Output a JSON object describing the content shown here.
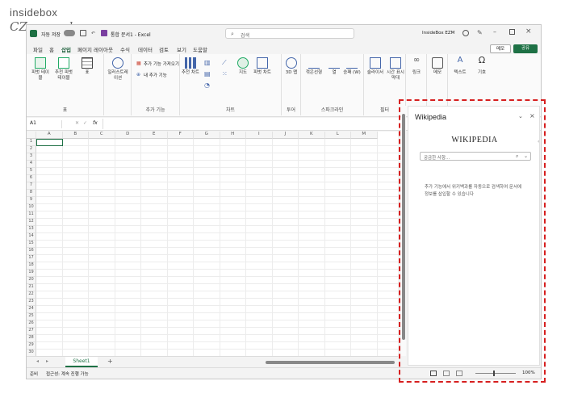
{
  "watermark": {
    "line1": "insidebox",
    "line2": "CZmanual"
  },
  "titlebar": {
    "autosave": "자동 저장",
    "doc_title": "통합 문서1 - Excel",
    "search_placeholder": "검색",
    "user": "InsideBox EZM"
  },
  "tabs": [
    "파일",
    "홈",
    "삽입",
    "페이지 레이아웃",
    "수식",
    "데이터",
    "검토",
    "보기",
    "도움말"
  ],
  "active_tab": "삽입",
  "ribbon_right": {
    "memo": "메모",
    "share": "공유"
  },
  "ribbon": {
    "pivot_table": "피벗 테이블",
    "recommended_pivot": "추천 피벗 테이블",
    "table": "표",
    "illustrations": "일러스트레이션",
    "get_addins": "추가 기능 가져오기",
    "my_addins": "내 추가 기능",
    "recommended_charts": "추천 차트",
    "maps": "지도",
    "pivot_chart": "피벗 차트",
    "map3d": "3D 맵",
    "line": "꺾은선형",
    "column": "열",
    "win_loss": "승패 (W)",
    "slicer": "슬라이서",
    "timeline": "시간 표시 막대",
    "link": "링크",
    "comment": "메모",
    "text": "텍스트",
    "symbol": "기호",
    "groups": {
      "tables": "표",
      "addins": "추가 기능",
      "charts": "차트",
      "tours": "투어",
      "sparklines": "스파크라인",
      "filters": "필터",
      "links": "링크",
      "comments": "메모"
    }
  },
  "formula_bar": {
    "name_box": "A1",
    "fx": "fx"
  },
  "grid": {
    "columns": [
      "A",
      "B",
      "C",
      "D",
      "E",
      "F",
      "G",
      "H",
      "I",
      "J",
      "K",
      "L",
      "M"
    ],
    "rows": [
      "1",
      "2",
      "3",
      "4",
      "5",
      "6",
      "7",
      "8",
      "9",
      "10",
      "11",
      "12",
      "13",
      "14",
      "15",
      "16",
      "17",
      "18",
      "19",
      "20",
      "21",
      "22",
      "23",
      "24",
      "25",
      "26",
      "27",
      "28",
      "29",
      "30"
    ]
  },
  "sheet": {
    "tab": "Sheet1",
    "add": "+"
  },
  "status": {
    "ready": "준비",
    "accessibility": "접근성: 계속 진행 가능",
    "zoom": "100%"
  },
  "pane": {
    "title": "Wikipedia",
    "logo": "WIKIPEDIA",
    "search_placeholder": "궁금한 사항...",
    "message": "추가 기능에서 위키백과를 자동으로 검색하여 문서에 정보를 삽입할 수 있습니다"
  }
}
